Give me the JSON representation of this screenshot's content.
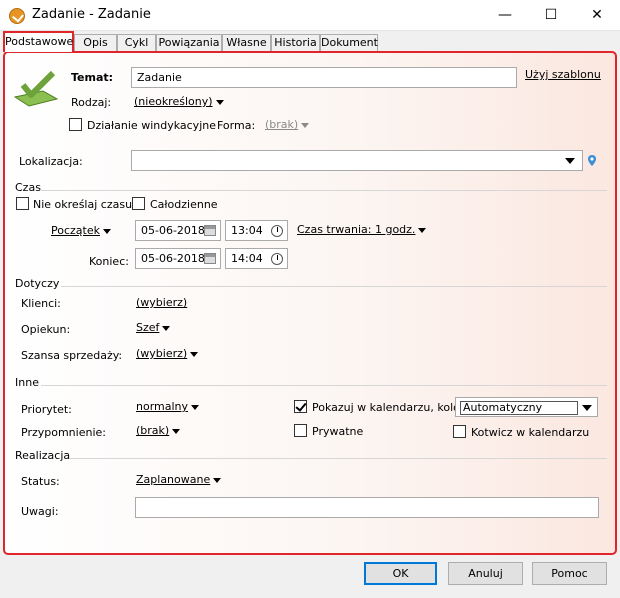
{
  "window": {
    "title": "Zadanie - Zadanie",
    "minimize": "—",
    "maximize": "☐",
    "close": "✕"
  },
  "tabs": [
    {
      "label": "Podstawowe"
    },
    {
      "label": "Opis"
    },
    {
      "label": "Cykl"
    },
    {
      "label": "Powiązania"
    },
    {
      "label": "Własne"
    },
    {
      "label": "Historia"
    },
    {
      "label": "Dokument"
    }
  ],
  "form": {
    "temat_label": "Temat:",
    "temat_value": "Zadanie",
    "template_link": "Użyj szablonu",
    "rodzaj_label": "Rodzaj:",
    "rodzaj_value": "(nieokreślony)",
    "windykacyjne_label": "Działanie windykacyjne",
    "forma_label": "Forma:",
    "forma_value": "(brak)",
    "lokalizacja_label": "Lokalizacja:",
    "lokalizacja_value": ""
  },
  "czas": {
    "section": "Czas",
    "no_time_label": "Nie określaj czasu",
    "all_day_label": "Całodzienne",
    "start_label": "Początek",
    "start_date": "05-06-2018",
    "start_time": "13:04",
    "duration_label": "Czas trwania: 1 godz.",
    "end_label": "Koniec:",
    "end_date": "05-06-2018",
    "end_time": "14:04"
  },
  "dotyczy": {
    "section": "Dotyczy",
    "klienci_label": "Klienci:",
    "klienci_value": "(wybierz)",
    "opiekun_label": "Opiekun:",
    "opiekun_value": "Szef",
    "szansa_label": "Szansa sprzedaży:",
    "szansa_value": "(wybierz)"
  },
  "inne": {
    "section": "Inne",
    "priorytet_label": "Priorytet:",
    "priorytet_value": "normalny",
    "przypomnienie_label": "Przypomnienie:",
    "przypomnienie_value": "(brak)",
    "show_calendar_label": "Pokazuj w kalendarzu, kolor:",
    "color_value": "Automatyczny",
    "private_label": "Prywatne",
    "anchor_label": "Kotwicz w kalendarzu"
  },
  "realizacja": {
    "section": "Realizacja",
    "status_label": "Status:",
    "status_value": "Zaplanowane",
    "uwagi_label": "Uwagi:",
    "uwagi_value": ""
  },
  "buttons": {
    "ok": "OK",
    "cancel": "Anuluj",
    "help": "Pomoc"
  },
  "colors": {
    "accent": "#e0262b",
    "default_button": "#0078d7",
    "icon_green": "#6ea23a"
  }
}
